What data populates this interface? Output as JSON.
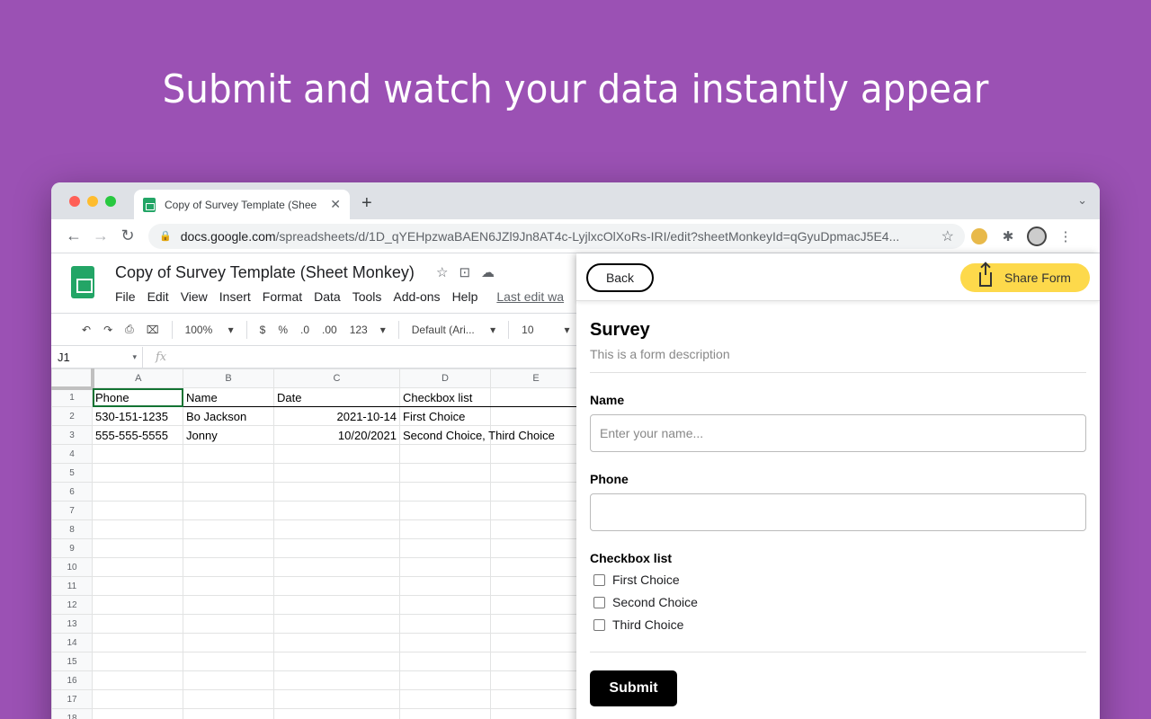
{
  "headline": "Submit and watch your data instantly appear",
  "browser": {
    "tab_title": "Copy of Survey Template (Shee",
    "url_host": "docs.google.com",
    "url_path": "/spreadsheets/d/1D_qYEHpzwaBAEN6JZl9Jn8AT4c-LyjlxcOlXoRs-IRI/edit?sheetMonkeyId=qGyuDpmacJ5E4..."
  },
  "sheets": {
    "doc_title": "Copy of Survey Template (Sheet Monkey)",
    "menu": [
      "File",
      "Edit",
      "View",
      "Insert",
      "Format",
      "Data",
      "Tools",
      "Add-ons",
      "Help"
    ],
    "last_edit": "Last edit wa",
    "toolbar": {
      "zoom": "100%",
      "currency": "$",
      "percent": "%",
      "dec_less": ".0",
      "dec_more": ".00",
      "format": "123",
      "font": "Default (Ari...",
      "size": "10"
    },
    "name_box": "J1",
    "fx": "fx",
    "columns": [
      "A",
      "B",
      "C",
      "D",
      "E"
    ],
    "rows": [
      [
        "Phone",
        "Name",
        "Date",
        "Checkbox list",
        ""
      ],
      [
        "530-151-1235",
        "Bo Jackson",
        "2021-10-14",
        "First Choice",
        ""
      ],
      [
        "555-555-5555",
        "Jonny",
        "10/20/2021",
        "Second Choice, Third Choice",
        ""
      ]
    ],
    "row_numbers": [
      "1",
      "2",
      "3",
      "4",
      "5",
      "6",
      "7",
      "8",
      "9",
      "10",
      "11",
      "12",
      "13",
      "14",
      "15",
      "16",
      "17",
      "18"
    ]
  },
  "panel": {
    "back_label": "Back",
    "share_label": "Share Form",
    "title": "Survey",
    "description": "This is a form description",
    "name_label": "Name",
    "name_placeholder": "Enter your name...",
    "phone_label": "Phone",
    "checkbox_label": "Checkbox list",
    "choices": [
      "First Choice",
      "Second Choice",
      "Third Choice"
    ],
    "submit_label": "Submit"
  }
}
